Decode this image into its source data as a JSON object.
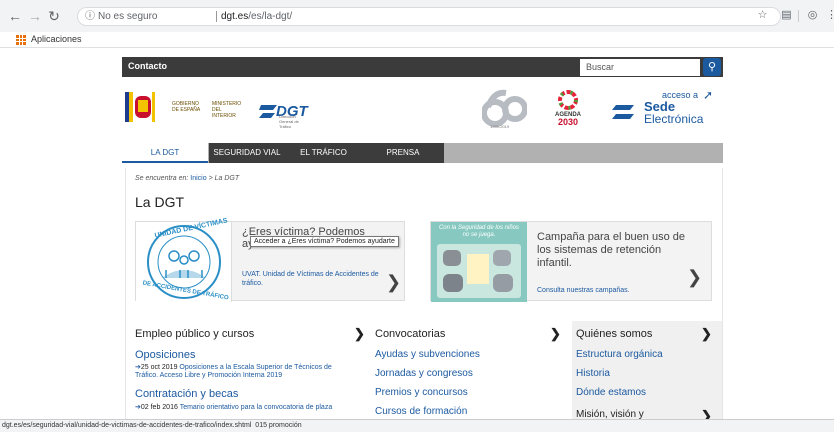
{
  "browser": {
    "secure_label": "No es seguro",
    "host": "dgt.es",
    "path": "/es/la-dgt/",
    "bookmark_label": "Aplicaciones",
    "status_url": "dgt.es/es/seguridad-vial/unidad-de-victimas-de-accidentes-de-trafico/index.shtml",
    "status_suffix": "015  promoción"
  },
  "header": {
    "contact": "Contacto",
    "search_placeholder": "Buscar",
    "gov_line": "GOBIERNO DE ESPAÑA",
    "ministry_line": "MINISTERIO DEL INTERIOR",
    "dgt_logo": "DGT",
    "dgt_sub": "Dirección General de Tráfico",
    "sixty_sub": "1959-2019",
    "agenda_title": "AGENDA",
    "agenda_year": "2030",
    "sede_top": "acceso a",
    "sede_main": "Sede",
    "sede_sub": "Electrónica"
  },
  "nav": {
    "tabs": [
      "LA DGT",
      "SEGURIDAD VIAL",
      "EL TRÁFICO",
      "PRENSA"
    ]
  },
  "breadcrumb": {
    "prefix": "Se encuentra en:",
    "home": "Inicio",
    "sep": ">",
    "current": "La DGT"
  },
  "page_title": "La DGT",
  "card_victims": {
    "title": "¿Eres víctima? Podemos ayudarte",
    "link": "UVAT. Unidad de Víctimas de Accidentes de tráfico.",
    "tooltip": "Acceder a ¿Eres víctima? Podemos ayudarte",
    "badge_top": "UNIDAD DE VÍCTIMAS",
    "badge_bottom": "DE ACCIDENTES DE TRÁFICO"
  },
  "card_campaign": {
    "title": "Campaña para el buen uso de los sistemas de retención infantil.",
    "link": "Consulta nuestras campañas.",
    "banner": "Con la Seguridad de los niños no se juega."
  },
  "columns": {
    "col1_title": "Empleo público y cursos",
    "col2_title": "Convocatorias",
    "col3_title": "Quiénes somos",
    "col1_sub1": "Oposiciones",
    "col1_news1_date": "25 oct 2019",
    "col1_news1_text": "Oposiciones a la Escala Superior de Técnicos de Tráfico. Acceso Libre y Promoción Interna 2019",
    "col1_sub2": "Contratación y becas",
    "col1_news2_date": "02 feb 2016",
    "col1_news2_text": "Temario orientativo para la convocatoria de plaza",
    "col2_links": [
      "Ayudas y subvenciones",
      "Jornadas y congresos",
      "Premios y concursos",
      "Cursos de formación"
    ],
    "col3_links": [
      "Estructura orgánica",
      "Historia",
      "Dónde estamos",
      "Misión, visión y"
    ]
  }
}
